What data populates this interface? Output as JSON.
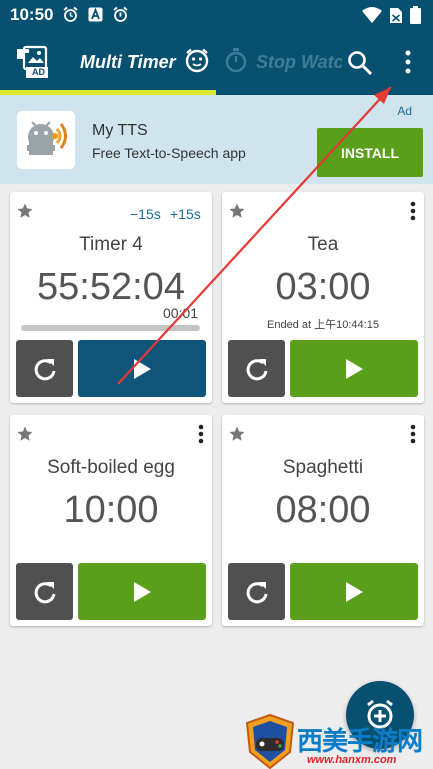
{
  "status_bar": {
    "time": "10:50",
    "icons": [
      "alarm-clock-icon",
      "app-a-icon",
      "alarm-clock-icon",
      "wifi-icon",
      "no-sim-icon",
      "battery-icon"
    ]
  },
  "app_bar": {
    "tabs": [
      {
        "label": "Multi Timer",
        "active": true
      },
      {
        "label": "Stop Watc",
        "active": false
      }
    ],
    "ad_icon_label": "AD"
  },
  "ad_banner": {
    "badge": "Ad",
    "app_name": "My TTS",
    "description": "Free Text-to-Speech app",
    "install_label": "INSTALL"
  },
  "timers": [
    {
      "name": "Timer 4",
      "time": "55:52:04",
      "sub": "00:01",
      "minus": "−15s",
      "plus": "+15s",
      "running": true
    },
    {
      "name": "Tea",
      "time": "03:00",
      "ended": "Ended at 上午10:44:15"
    },
    {
      "name": "Soft-boiled egg",
      "time": "10:00"
    },
    {
      "name": "Spaghetti",
      "time": "08:00"
    }
  ],
  "watermark": {
    "text": "西美手游网",
    "url": "www.hanxm.com"
  },
  "colors": {
    "primary": "#08506f",
    "accent_indicator": "#dcea28",
    "play_green": "#5a9f1a",
    "play_blue": "#0f5479",
    "reset_gray": "#505050",
    "annotation_arrow": "#e53935"
  }
}
